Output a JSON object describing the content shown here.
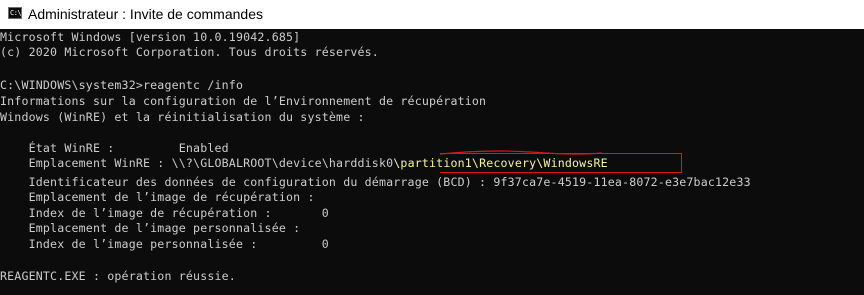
{
  "window": {
    "title": "Administrateur : Invite de commandes",
    "icon": "cmd-icon",
    "icon_text": "C:\\"
  },
  "console": {
    "lines": [
      "Microsoft Windows [version 10.0.19042.685]",
      "(c) 2020 Microsoft Corporation. Tous droits réservés.",
      "",
      "C:\\WINDOWS\\system32>reagentc /info",
      "Informations sur la configuration de l’Environnement de récupération",
      "Windows (WinRE) et la réinitialisation du système :",
      "",
      "    État WinRE :         Enabled",
      "",
      "    Identificateur des données de configuration du démarrage (BCD) : 9f37ca7e-4519-11ea-8072-e3e7bac12e33",
      "    Emplacement de l’image de récupération :",
      "    Index de l’image de récupération :       0",
      "    Emplacement de l’image personnalisée :",
      "    Index de l’image personnalisée :         0",
      "",
      "REAGENTC.EXE : opération réussie."
    ],
    "winre_location": {
      "prefix": "    Emplacement WinRE : \\\\?\\GLOBALROOT\\device\\harddisk0",
      "highlighted": "\\partition1\\Recovery\\WindowsRE"
    }
  },
  "colors": {
    "background": "#0c0c0c",
    "text": "#cccccc",
    "highlight_text": "#f4f49a",
    "annotation": "#e11414",
    "titlebar": "#ffffff"
  }
}
